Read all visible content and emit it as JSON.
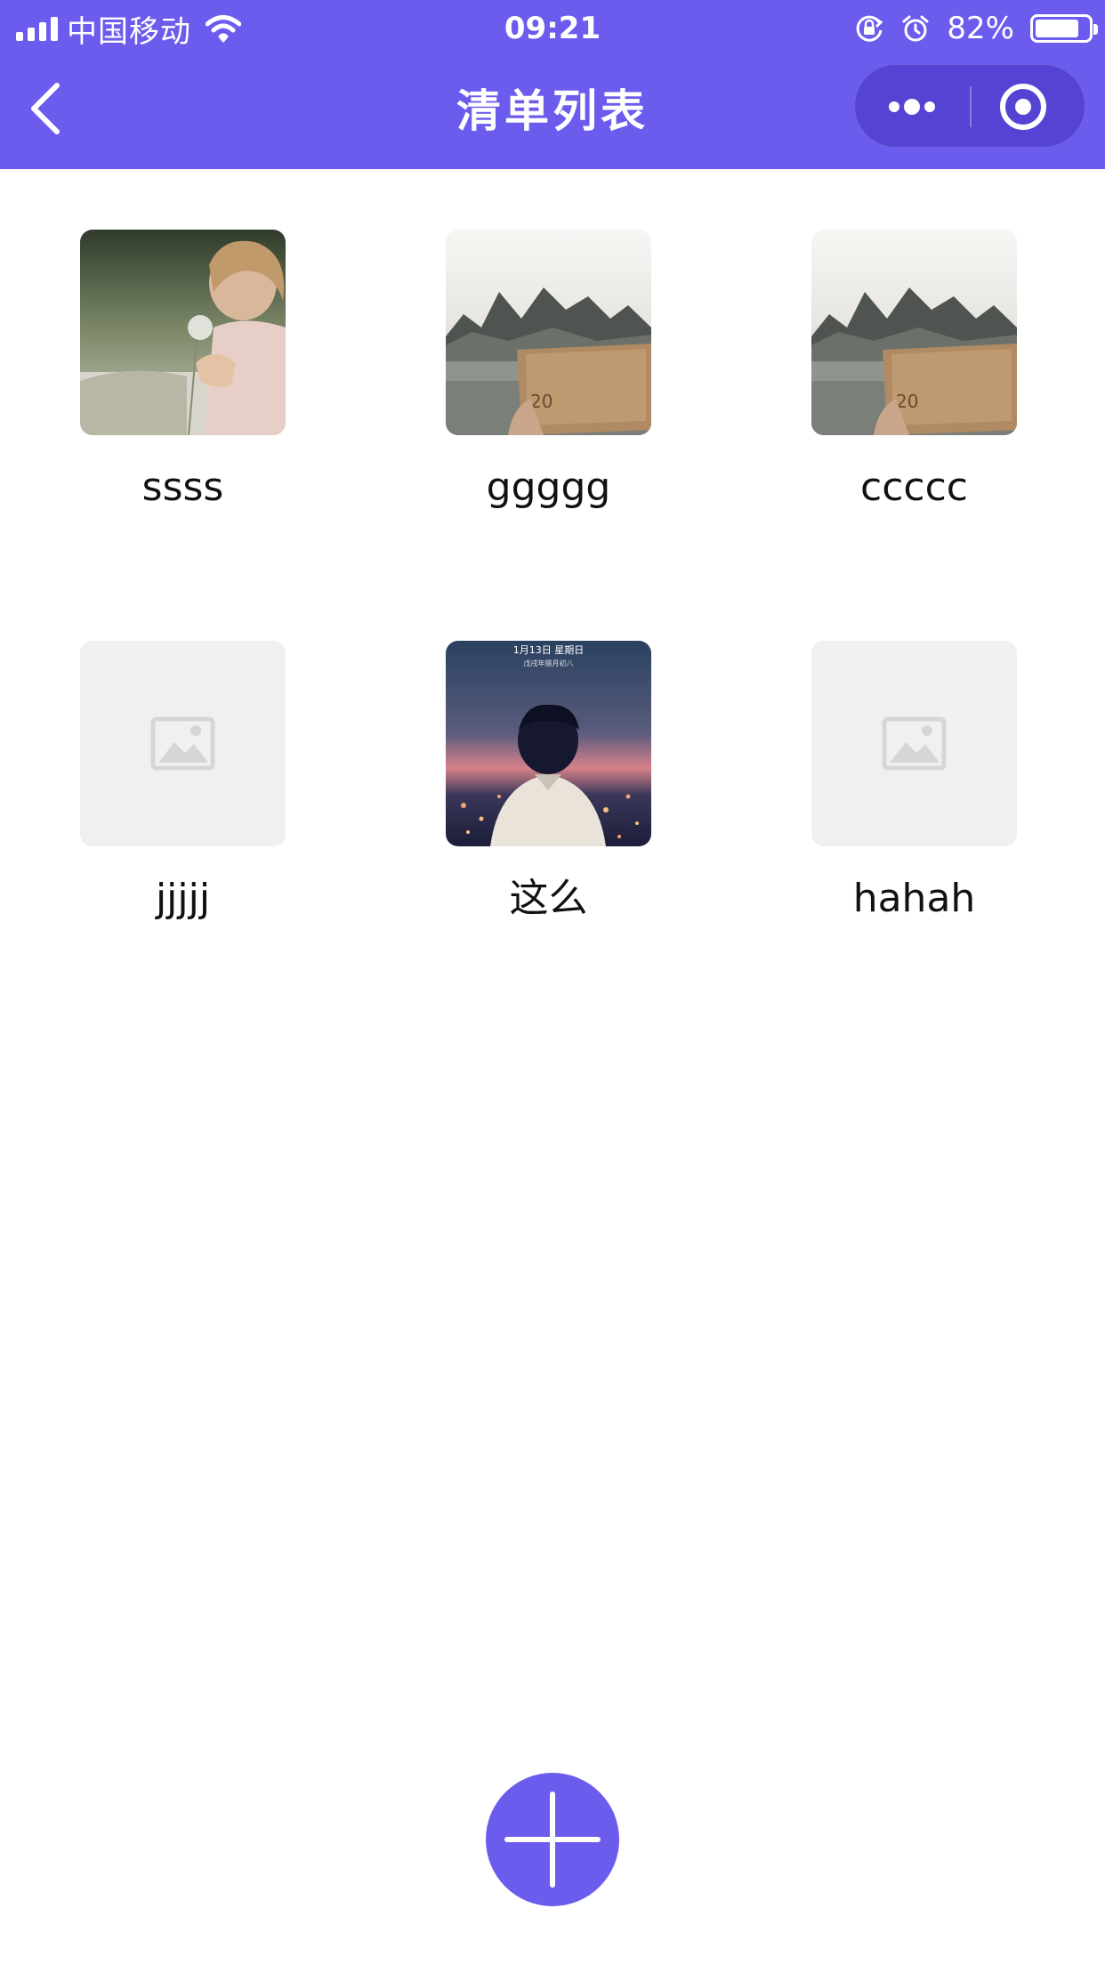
{
  "status_bar": {
    "carrier": "中国移动",
    "time": "09:21",
    "battery_percent": "82%",
    "battery_level": 0.82,
    "icons": [
      "signal-icon",
      "wifi-icon",
      "rotation-lock-icon",
      "alarm-icon",
      "battery-icon"
    ]
  },
  "nav": {
    "title": "清单列表",
    "back_icon": "chevron-left-icon",
    "menu_icon": "more-dots-icon",
    "close_icon": "target-circle-icon"
  },
  "items": [
    {
      "label": "ssss",
      "image": "photo-child-dandelion"
    },
    {
      "label": "ggggg",
      "image": "photo-landscape-banknote"
    },
    {
      "label": "ccccc",
      "image": "photo-landscape-banknote"
    },
    {
      "label": "jjjjj",
      "image": "placeholder-image"
    },
    {
      "label": "这么",
      "image": "photo-illustration-boy-night",
      "image_text_1": "1月13日 星期日",
      "image_text_2": "戊戌年腊月初八"
    },
    {
      "label": "hahah",
      "image": "placeholder-image"
    }
  ],
  "add_button": {
    "icon": "plus-icon"
  },
  "colors": {
    "accent": "#6b5cee",
    "placeholder_bg": "#f0f0f0",
    "text": "#111111"
  }
}
